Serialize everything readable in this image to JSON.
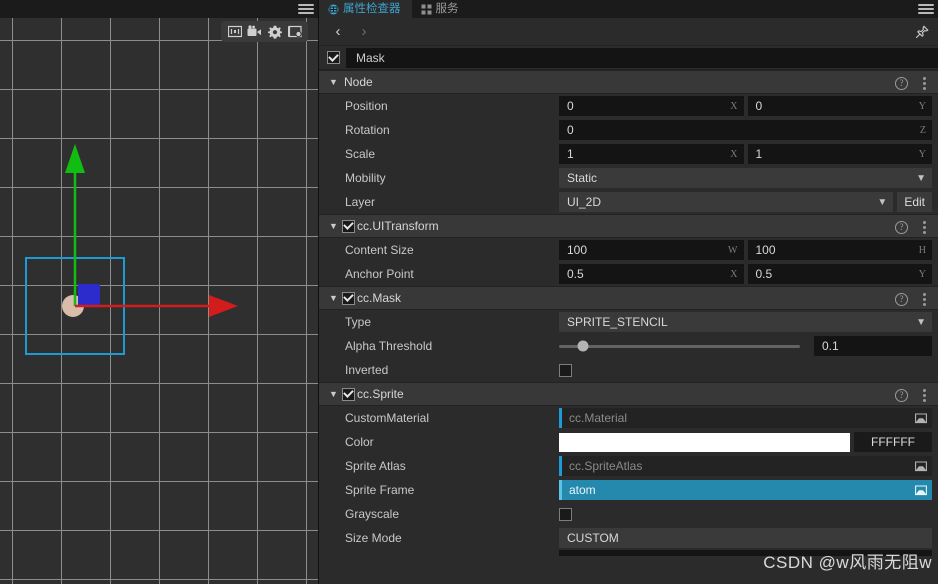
{
  "scene": {
    "hamburger_icon": "hamburger-menu-icon",
    "toolbar": [
      {
        "name": "gizmo-scale-icon",
        "label": "Gizmo Scale"
      },
      {
        "name": "camera-icon",
        "label": "Camera"
      },
      {
        "name": "gear-icon",
        "label": "Settings"
      },
      {
        "name": "grid-settings-icon",
        "label": "Grid Settings"
      }
    ],
    "gizmo": {
      "x_axis_color": "#d31c1c",
      "y_axis_color": "#12bd12",
      "selection_color": "#1e9ad6"
    },
    "sprite": {
      "circle_color": "#d9bdaa",
      "square_color": "#2c2ccd"
    }
  },
  "tabs": [
    {
      "label": "属性检查器",
      "icon": "inspector-icon",
      "active": true
    },
    {
      "label": "服务",
      "icon": "services-icon",
      "active": false
    }
  ],
  "tabstrip": {
    "menu_icon": "hamburger-menu-icon"
  },
  "navbar": {
    "back_label": "‹",
    "forward_label": "›",
    "pin_icon": "pin-icon"
  },
  "node": {
    "enabled": true,
    "name": "Mask"
  },
  "sections": [
    {
      "id": "node",
      "title": "Node",
      "has_checkbox": false,
      "checked": false,
      "expanded": true,
      "rows": [
        {
          "type": "vec2",
          "label": "Position",
          "x": "0",
          "y": "0",
          "x_axis": "X",
          "y_axis": "Y"
        },
        {
          "type": "num1",
          "label": "Rotation",
          "value": "0",
          "axis": "Z"
        },
        {
          "type": "vec2",
          "label": "Scale",
          "x": "1",
          "y": "1",
          "x_axis": "X",
          "y_axis": "Y"
        },
        {
          "type": "select",
          "label": "Mobility",
          "value": "Static"
        },
        {
          "type": "select_edit",
          "label": "Layer",
          "value": "UI_2D",
          "button": "Edit"
        }
      ]
    },
    {
      "id": "uitransform",
      "title": "cc.UITransform",
      "has_checkbox": true,
      "checked": true,
      "expanded": true,
      "rows": [
        {
          "type": "vec2",
          "label": "Content Size",
          "x": "100",
          "y": "100",
          "x_axis": "W",
          "y_axis": "H"
        },
        {
          "type": "vec2",
          "label": "Anchor Point",
          "x": "0.5",
          "y": "0.5",
          "x_axis": "X",
          "y_axis": "Y"
        }
      ]
    },
    {
      "id": "mask",
      "title": "cc.Mask",
      "has_checkbox": true,
      "checked": true,
      "expanded": true,
      "rows": [
        {
          "type": "select",
          "label": "Type",
          "value": "SPRITE_STENCIL"
        },
        {
          "type": "slider",
          "label": "Alpha Threshold",
          "value": "0.1",
          "percent": 10
        },
        {
          "type": "checkbox",
          "label": "Inverted",
          "checked": false
        }
      ]
    },
    {
      "id": "sprite",
      "title": "cc.Sprite",
      "has_checkbox": true,
      "checked": true,
      "expanded": true,
      "rows": [
        {
          "type": "asset",
          "label": "CustomMaterial",
          "value": "cc.Material",
          "filled": false
        },
        {
          "type": "color",
          "label": "Color",
          "swatch": "#FFFFFF",
          "hex": "FFFFFF"
        },
        {
          "type": "asset",
          "label": "Sprite Atlas",
          "value": "cc.SpriteAtlas",
          "filled": false
        },
        {
          "type": "asset",
          "label": "Sprite Frame",
          "value": "atom",
          "filled": true
        },
        {
          "type": "checkbox",
          "label": "Grayscale",
          "checked": false
        },
        {
          "type": "sizemode",
          "label": "Size Mode",
          "value": "CUSTOM"
        }
      ]
    }
  ],
  "watermark": "CSDN @w风雨无阻w"
}
